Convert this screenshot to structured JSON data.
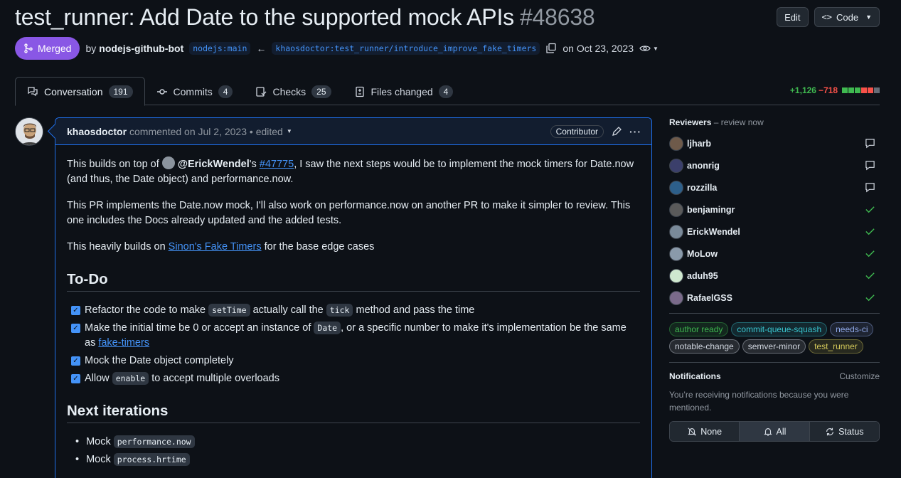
{
  "header": {
    "title": "test_runner: Add Date to the supported mock APIs",
    "number": "#48638",
    "edit_label": "Edit",
    "code_label": "Code"
  },
  "meta": {
    "state": "Merged",
    "by": "by",
    "author": "nodejs-github-bot",
    "base_branch": "nodejs:main",
    "head_branch": "khaosdoctor:test_runner/introduce_improve_fake_timers",
    "date": "on Oct 23, 2023"
  },
  "tabs": [
    {
      "label": "Conversation",
      "count": "191"
    },
    {
      "label": "Commits",
      "count": "4"
    },
    {
      "label": "Checks",
      "count": "25"
    },
    {
      "label": "Files changed",
      "count": "4"
    }
  ],
  "diffstat": {
    "additions": "+1,126",
    "deletions": "−718"
  },
  "colors": {
    "accent": "#4493f8",
    "merged": "#8957e5",
    "add": "#3fb950",
    "del": "#f85149"
  },
  "comment": {
    "author": "khaosdoctor",
    "action": "commented on Jul 2, 2023 • edited",
    "role": "Contributor",
    "p1_a": "This builds on top of ",
    "p1_user": "@ErickWendel",
    "p1_b": "'s ",
    "p1_link": "#47775",
    "p1_c": ", I saw the next steps would be to implement the mock timers for Date.now (and thus, the Date object) and performance.now.",
    "p2": "This PR implements the Date.now mock, I'll also work on performance.now on another PR to make it simpler to review. This one includes the Docs already updated and the added tests.",
    "p3_a": "This heavily builds on ",
    "p3_link": "Sinon's Fake Timers",
    "p3_b": " for the base edge cases",
    "todo_heading": "To-Do",
    "tasks": [
      {
        "a": "Refactor the code to make ",
        "code": "setTime",
        "b": " actually call the ",
        "code2": "tick",
        "c": " method and pass the time"
      },
      {
        "a": "Make the initial time be 0 or accept an instance of ",
        "code": "Date",
        "b": ", or a specific number to make it's implementation be the same as ",
        "link": "fake-timers"
      },
      {
        "a": "Mock the Date object completely"
      },
      {
        "a": "Allow ",
        "code": "enable",
        "b": " to accept multiple overloads"
      }
    ],
    "next_heading": "Next iterations",
    "next_items": [
      {
        "a": "Mock ",
        "code": "performance.now"
      },
      {
        "a": "Mock ",
        "code": "process.hrtime"
      }
    ]
  },
  "sidebar": {
    "reviewers_title": "Reviewers",
    "reviewers_sub": " – review now",
    "reviewers": [
      {
        "name": "ljharb",
        "status": "comment-icon",
        "color": "#6e5a4a"
      },
      {
        "name": "anonrig",
        "status": "comment-icon",
        "color": "#3b3f6b"
      },
      {
        "name": "rozzilla",
        "status": "comment-icon",
        "color": "#2d5f8a"
      },
      {
        "name": "benjamingr",
        "status": "check-icon",
        "color": "#5a5a5a"
      },
      {
        "name": "ErickWendel",
        "status": "check-icon",
        "color": "#7a8a9a"
      },
      {
        "name": "MoLow",
        "status": "check-icon",
        "color": "#8a9aaa"
      },
      {
        "name": "aduh95",
        "status": "check-icon",
        "color": "#cfe8cf"
      },
      {
        "name": "RafaelGSS",
        "status": "check-icon",
        "color": "#7a6a8a"
      }
    ],
    "labels": [
      {
        "name": "author ready",
        "color": "#3fb950"
      },
      {
        "name": "commit-queue-squash",
        "color": "#39c5cf"
      },
      {
        "name": "needs-ci",
        "color": "#8fa8e8"
      },
      {
        "name": "notable-change",
        "color": "#d1d7e0"
      },
      {
        "name": "semver-minor",
        "color": "#d1d7e0"
      },
      {
        "name": "test_runner",
        "color": "#d4c95a"
      }
    ],
    "notifications_title": "Notifications",
    "customize": "Customize",
    "notif_text": "You’re receiving notifications because you were mentioned.",
    "seg_none": "None",
    "seg_all": "All",
    "seg_status": "Status"
  }
}
